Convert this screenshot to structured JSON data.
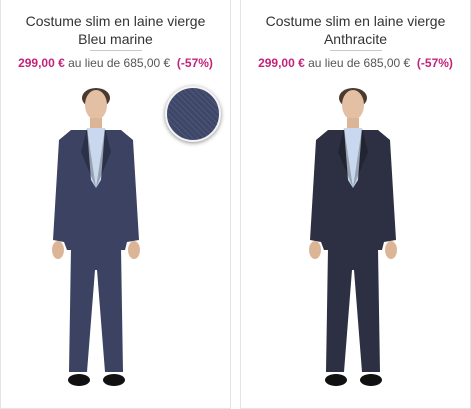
{
  "products": [
    {
      "title_line1": "Costume slim en laine vierge",
      "title_line2": "Bleu marine",
      "price_now": "299,00 €",
      "price_text": "au lieu de",
      "price_was": "685,00 €",
      "discount": "(-57%)",
      "suit_color": "#3b4262",
      "swatch_color": "#3e4768"
    },
    {
      "title_line1": "Costume slim en laine vierge",
      "title_line2": "Anthracite",
      "price_now": "299,00 €",
      "price_text": "au lieu de",
      "price_was": "685,00 €",
      "discount": "(-57%)",
      "suit_color": "#2c3042"
    }
  ],
  "accent": "#c2237b"
}
